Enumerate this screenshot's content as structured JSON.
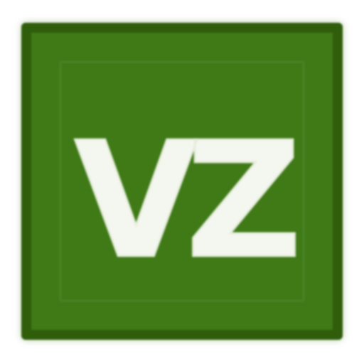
{
  "icon": {
    "name": "vz-app-icon",
    "monogram": "VZ",
    "colors": {
      "background": "#3f7a17",
      "border": "#2f5d0a",
      "glyph": "#f4f7ef"
    }
  }
}
